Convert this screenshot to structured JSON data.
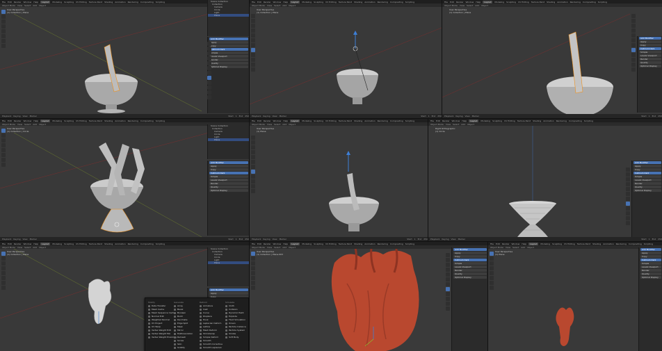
{
  "menu": [
    "File",
    "Edit",
    "Render",
    "Window",
    "Help"
  ],
  "workspaces": [
    "Layout",
    "Modeling",
    "Sculpting",
    "UV Editing",
    "Texture Paint",
    "Shading",
    "Animation",
    "Rendering",
    "Compositing",
    "Scripting"
  ],
  "header_labels": [
    "Object Mode",
    "View",
    "Select",
    "Add",
    "Object"
  ],
  "viewport_labels": {
    "t1": [
      "User Perspective",
      "(1) Collection | Plane"
    ],
    "t2": [
      "User Perspective",
      "(1) Collection | Plane"
    ],
    "t3": [
      "User Perspective",
      "(1) Collection | Plane"
    ],
    "t4": [
      "User Perspective",
      "(1) Collection | Circle"
    ],
    "t5": [
      "User Perspective",
      "(1) Plane"
    ],
    "t6": [
      "Right Orthographic",
      "(1) Circle"
    ],
    "t7": [
      "User Perspective",
      "(1) Collection | Plane"
    ],
    "t8": [
      "User Perspective",
      "(1) Collection | Plane.003"
    ],
    "t9": [
      "User Perspective",
      "(1) Plane"
    ]
  },
  "outliner": {
    "root": "Scene Collection",
    "collection": "Collection",
    "items": [
      "Camera",
      "Circle",
      "Light",
      "Plane"
    ]
  },
  "timeline": [
    "Playback",
    "Keying",
    "View",
    "Marker"
  ],
  "frame": {
    "start": "Start",
    "start_val": "1",
    "end": "End",
    "end_val": "250"
  },
  "props": {
    "add_modifier": "Add Modifier",
    "apply": "Apply",
    "copy": "Copy",
    "subdivision": "Catmull-Clark",
    "simple": "Simple",
    "levels_viewport": "Levels Viewport",
    "render": "Render",
    "quality": "Quality",
    "optimal_display": "Optimal Display"
  },
  "add_menu": {
    "cols": [
      {
        "head": "Modify",
        "items": [
          "Data Transfer",
          "Mesh Cache",
          "Mesh Sequence Cache",
          "Normal Edit",
          "Weighted Normal",
          "UV Project",
          "UV Warp",
          "Vertex Weight Edit",
          "Vertex Weight Mix",
          "Vertex Weight Proximity"
        ]
      },
      {
        "head": "Generate",
        "items": [
          "Array",
          "Bevel",
          "Boolean",
          "Build",
          "Decimate",
          "Edge Split",
          "Mask",
          "Mirror",
          "Multiresolution",
          "Remesh",
          "Screw",
          "Skin",
          "Solidify",
          "Subdivision Surface",
          "Triangulate",
          "Wireframe"
        ]
      },
      {
        "head": "Deform",
        "items": [
          "Armature",
          "Cast",
          "Curve",
          "Displace",
          "Hook",
          "Laplacian Deform",
          "Lattice",
          "Mesh Deform",
          "Shrinkwrap",
          "Simple Deform",
          "Smooth",
          "Smooth Corrective",
          "Smooth Laplacian",
          "Surface Deform",
          "Warp",
          "Wave"
        ]
      },
      {
        "head": "Simulate",
        "items": [
          "Cloth",
          "Collision",
          "Dynamic Paint",
          "Explode",
          "Fluid Simulation",
          "Ocean",
          "Particle Instance",
          "Particle System",
          "Smoke",
          "Soft Body"
        ]
      }
    ]
  },
  "colors": {
    "accent": "#4772b3",
    "selected_orange": "#f0901a",
    "clay": "#b9482f",
    "mesh_gray": "#bdbdbd"
  }
}
